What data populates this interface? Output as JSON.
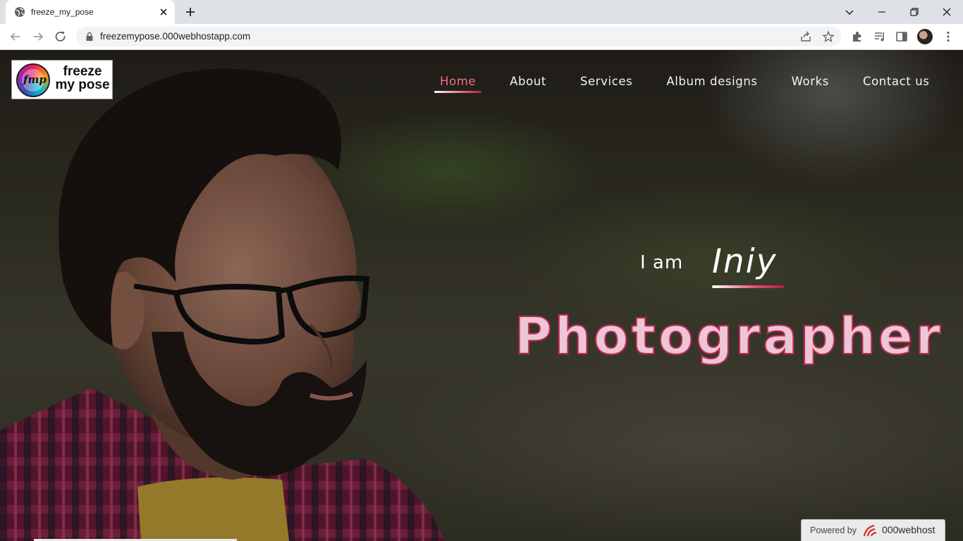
{
  "browser": {
    "tab_title": "freeze_my_pose",
    "url": "freezemypose.000webhostapp.com",
    "icons": [
      "globe-icon",
      "close-icon",
      "plus-icon",
      "chevron-down-icon",
      "minimize-icon",
      "restore-icon",
      "close-window-icon",
      "back-icon",
      "forward-icon",
      "reload-icon",
      "lock-icon",
      "share-icon",
      "star-icon",
      "extensions-icon",
      "media-icon",
      "side-panel-icon",
      "avatar",
      "more-icon"
    ]
  },
  "site": {
    "logo": {
      "mark": "fmp",
      "line1": "freeze",
      "line2": "my pose"
    },
    "nav": [
      {
        "label": "Home",
        "active": true
      },
      {
        "label": "About",
        "active": false
      },
      {
        "label": "Services",
        "active": false
      },
      {
        "label": "Album designs",
        "active": false
      },
      {
        "label": "Works",
        "active": false
      },
      {
        "label": "Contact us",
        "active": false
      }
    ],
    "hero": {
      "intro": "I am",
      "name": "Iniy",
      "headline": "Photographer"
    },
    "colors": {
      "accent": "#e0506f",
      "headline_fill": "#ecc6d6",
      "headline_stroke": "#c22a55"
    }
  },
  "hosting_badge": {
    "powered": "Powered by",
    "name": "000webhost"
  }
}
